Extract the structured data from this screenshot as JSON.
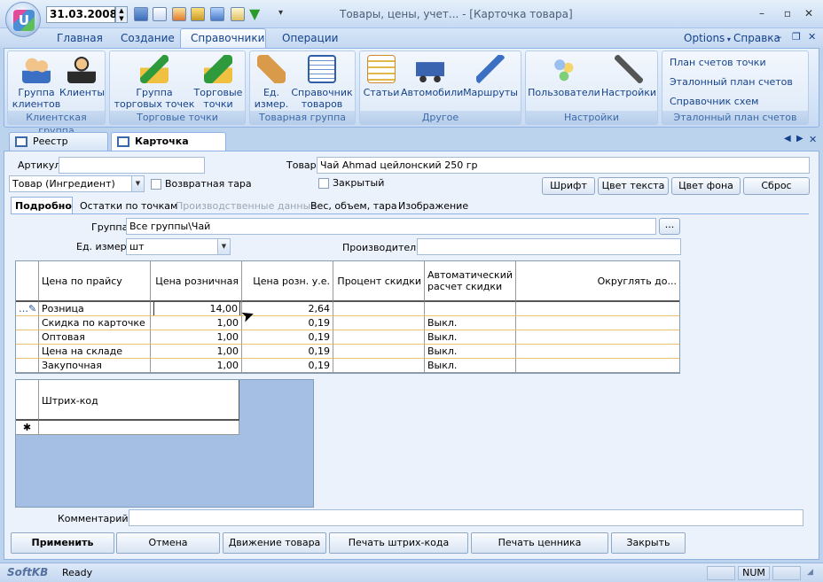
{
  "window": {
    "date": "31.03.2008",
    "title": "Товары, цены, учет... - [Карточка товара]"
  },
  "ribbon": {
    "tabs": [
      "Главная",
      "Создание",
      "Справочники",
      "Операции"
    ],
    "right_links": {
      "options": "Options",
      "help": "Справка"
    },
    "groups": [
      {
        "label": "Клиентская группа",
        "buttons": [
          "Группа клиентов",
          "Клиенты"
        ]
      },
      {
        "label": "Торговые точки",
        "buttons": [
          "Группа торговых точек",
          "Торговые точки"
        ]
      },
      {
        "label": "Товарная группа",
        "buttons": [
          "Ед. измер.",
          "Справочник товаров"
        ]
      },
      {
        "label": "Другое",
        "buttons": [
          "Статьи",
          "Автомобили",
          "Маршруты"
        ]
      },
      {
        "label": "Настройки",
        "buttons": [
          "Пользователи",
          "Настройки"
        ]
      },
      {
        "label": "Эталонный план счетов",
        "links": [
          "План счетов точки",
          "Эталонный план счетов",
          "Справочник схем проводок"
        ]
      }
    ]
  },
  "doc_tabs": [
    "Реестр товаров",
    "Карточка товара"
  ],
  "form": {
    "article_label": "Артикул",
    "article_value": "",
    "product_label": "Товар",
    "product_value": "Чай Ahmad цейлонский 250 гр",
    "type_value": "Товар (Ингредиент)",
    "returnable_label": "Возвратная тара",
    "closed_label": "Закрытый",
    "buttons": {
      "font": "Шрифт",
      "text_color": "Цвет текста",
      "bg_color": "Цвет фона",
      "reset": "Сброс"
    },
    "subtabs": [
      "Подробно",
      "Остатки по точкам",
      "Производственные данные",
      "Вес, объем, тара",
      "Изображение"
    ],
    "group_label": "Группа",
    "group_value": "Все группы\\Чай",
    "browse": "...",
    "unit_label": "Ед. измер.",
    "unit_value": "шт",
    "producer_label": "Производитель:",
    "producer_value": "",
    "comment_label": "Комментарий",
    "comment_value": ""
  },
  "price_grid": {
    "columns": [
      "Цена по прайсу",
      "Цена розничная",
      "Цена розн. у.е.",
      "Процент скидки",
      "Автоматический расчет скидки",
      "Округлять до..."
    ],
    "rows": [
      {
        "name": "Розница",
        "retail": "14,00",
        "retail_ue": "2,64",
        "discount": "",
        "auto": ""
      },
      {
        "name": "Скидка по карточке",
        "retail": "1,00",
        "retail_ue": "0,19",
        "discount": "",
        "auto": "Выкл."
      },
      {
        "name": "Оптовая",
        "retail": "1,00",
        "retail_ue": "0,19",
        "discount": "",
        "auto": "Выкл."
      },
      {
        "name": "Цена на складе",
        "retail": "1,00",
        "retail_ue": "0,19",
        "discount": "",
        "auto": "Выкл."
      },
      {
        "name": "Закупочная",
        "retail": "1,00",
        "retail_ue": "0,19",
        "discount": "",
        "auto": "Выкл."
      }
    ]
  },
  "barcode_grid": {
    "column": "Штрих-код",
    "new_row_marker": "✱"
  },
  "actions": [
    "Применить",
    "Отмена",
    "Движение товара",
    "Печать штрих-кода",
    "Печать ценника",
    "Закрыть"
  ],
  "status": {
    "brand": "SoftKB",
    "text": "Ready",
    "num": "NUM"
  },
  "colors": {
    "accent": "#15428b",
    "ribbon_bg": "#d3e3f7",
    "grid_sep": "#e8c46a"
  }
}
